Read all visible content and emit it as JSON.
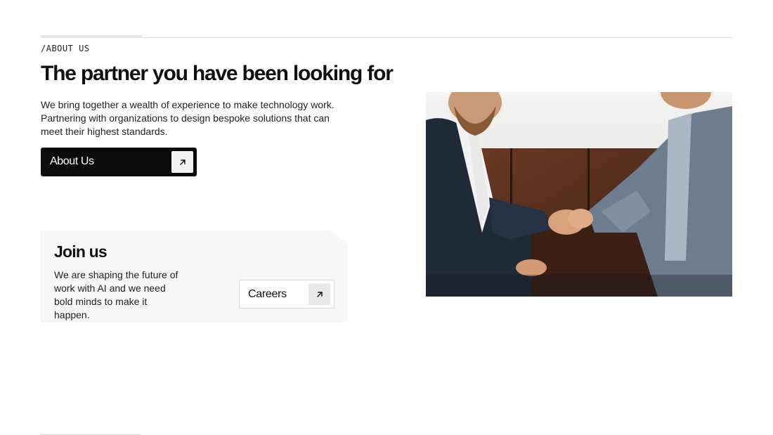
{
  "about": {
    "eyebrow": "/ABOUT US",
    "headline": "The partner you have been looking for",
    "intro": "We bring together a wealth of experience to make technology work. Partnering with organizations to design bespoke solutions that can meet their highest standards.",
    "cta_label": "About Us",
    "cta_icon": "arrow-up-right-icon"
  },
  "join": {
    "title": "Join us",
    "text": "We are shaping the future of work with AI and we need bold minds to make it happen.",
    "cta_label": "Careers",
    "cta_icon": "arrow-up-right-icon"
  },
  "image": {
    "subject": "two-men-shaking-hands-photo"
  },
  "colors": {
    "primary_button_bg": "#0b0b0b",
    "card_bg": "#f7f7f7",
    "text": "#111111"
  }
}
